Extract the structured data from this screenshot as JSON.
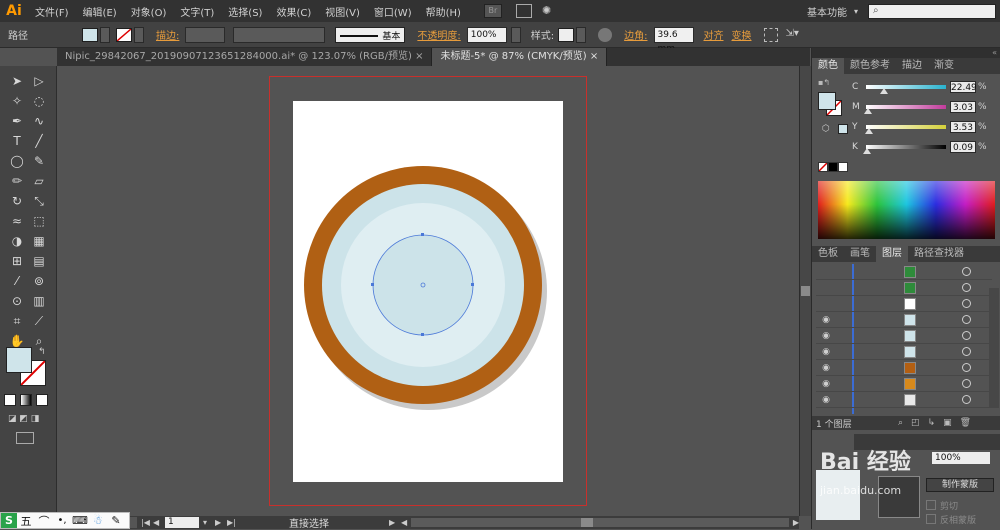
{
  "app": {
    "logo": "Ai",
    "workspace": "基本功能",
    "search_placeholder": ""
  },
  "menu": [
    "文件(F)",
    "编辑(E)",
    "对象(O)",
    "文字(T)",
    "选择(S)",
    "效果(C)",
    "视图(V)",
    "窗口(W)",
    "帮助(H)"
  ],
  "control": {
    "object_type": "路径",
    "stroke_label": "描边:",
    "brush_basic": "基本",
    "opacity_label": "不透明度:",
    "opacity_value": "100%",
    "style_label": "样式:",
    "corner_label": "边角:",
    "corner_value": "39.6 mm",
    "align_label": "对齐",
    "transform_label": "变换"
  },
  "tabs": [
    {
      "label": "Nipic_29842067_20190907123651284000.ai* @ 123.07% (RGB/预览)",
      "active": false
    },
    {
      "label": "未标题-5* @ 87% (CMYK/预览)",
      "active": true
    }
  ],
  "color_panel": {
    "tabs": [
      "颜色",
      "颜色参考",
      "描边",
      "渐变"
    ],
    "channels": [
      {
        "name": "C",
        "value": "22.49",
        "color": "#29b3cf",
        "pos": 0.22
      },
      {
        "name": "M",
        "value": "3.03",
        "color": "#c23c9c",
        "pos": 0.03
      },
      {
        "name": "Y",
        "value": "3.53",
        "color": "#d4d03a",
        "pos": 0.04
      },
      {
        "name": "K",
        "value": "0.09",
        "color": "#7a7a7a",
        "pos": 0.01
      }
    ],
    "pct": "%"
  },
  "layers_panel": {
    "tabs": [
      "色板",
      "画笔",
      "图层",
      "路径查找器"
    ],
    "footer": "1 个图层",
    "rows": [
      {
        "visible": false,
        "thumb": "#2e8b3a"
      },
      {
        "visible": false,
        "thumb": "#2e8b3a"
      },
      {
        "visible": false,
        "thumb": "#ffffff"
      },
      {
        "visible": true,
        "thumb": "#cfe4ea"
      },
      {
        "visible": true,
        "thumb": "#cfe4ea"
      },
      {
        "visible": true,
        "thumb": "#cfe4ea"
      },
      {
        "visible": true,
        "thumb": "#b35f12"
      },
      {
        "visible": true,
        "thumb": "#d88a1c"
      },
      {
        "visible": true,
        "thumb": "#e8e8e8"
      }
    ]
  },
  "transparency_panel": {
    "opacity": "100%",
    "make_mask": "制作蒙版",
    "clip": "剪切",
    "invert": "反相蒙版"
  },
  "status": {
    "zoom": "87%",
    "page": "1",
    "tool": "直接选择"
  },
  "watermark": "Bai 经验",
  "watermark_url": "jian.baidu.com",
  "ime": [
    "五",
    "⌒",
    "•,",
    "⌨",
    "☃",
    "✎"
  ],
  "colors": {
    "ring": "#b06014",
    "light": "#dfeef2",
    "mid": "#cce3e9",
    "artboard": "#ffffff",
    "shadow": "#c9c9c9"
  }
}
